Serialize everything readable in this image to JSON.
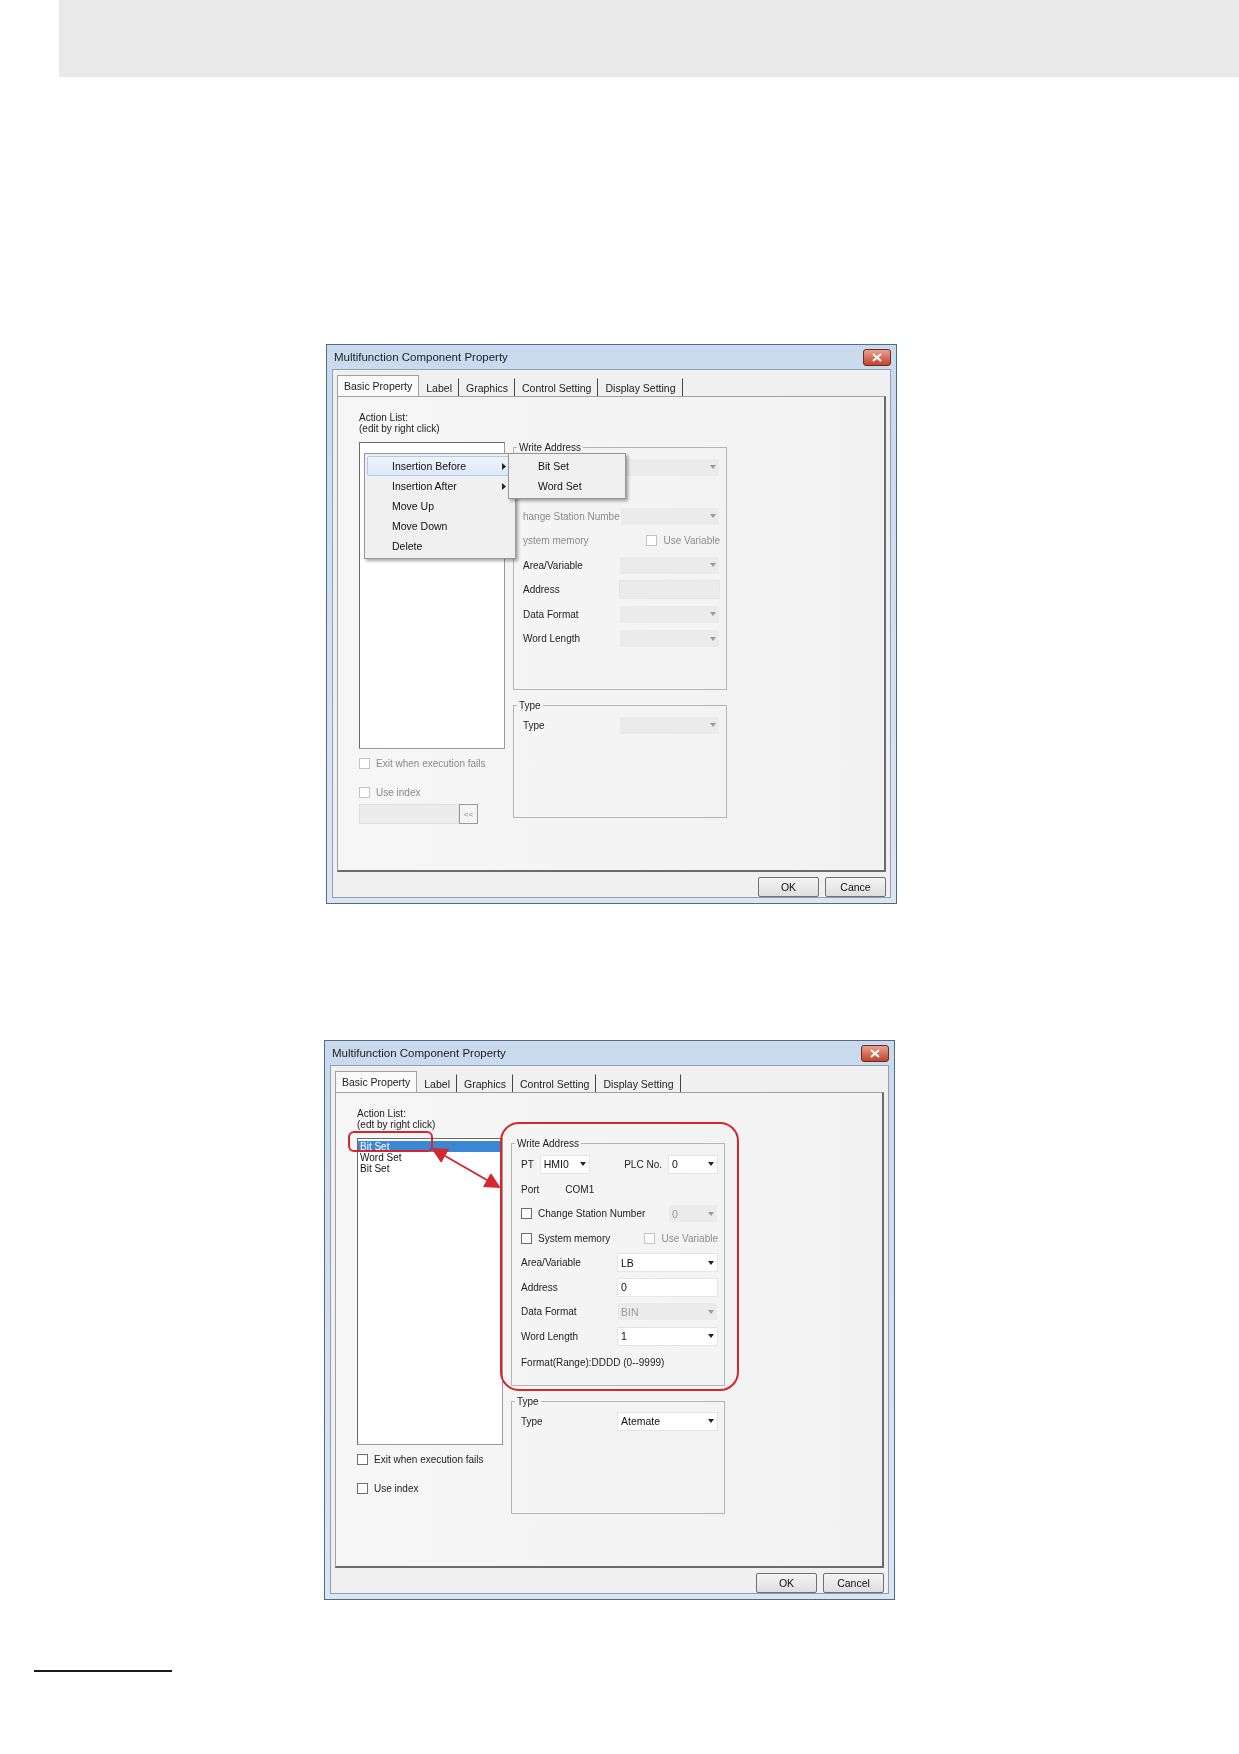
{
  "dialogs": [
    {
      "title": "Multifunction Component Property",
      "tabs": [
        {
          "label": "Basic Property",
          "selected": true
        },
        {
          "label": "Label",
          "selected": false
        },
        {
          "label": "Graphics",
          "selected": false
        },
        {
          "label": "Control Setting",
          "selected": false
        },
        {
          "label": "Display Setting",
          "selected": false
        }
      ],
      "action_list": {
        "label": "Action List:",
        "hint": "(edit by right click)"
      },
      "context_menu": {
        "items": [
          {
            "label": "Insertion Before",
            "selected": true,
            "submenu": true
          },
          {
            "label": "Insertion After",
            "selected": false,
            "submenu": true
          },
          {
            "label": "Move Up",
            "selected": false,
            "submenu": false
          },
          {
            "label": "Move Down",
            "selected": false,
            "submenu": false
          },
          {
            "label": "Delete",
            "selected": false,
            "submenu": false
          }
        ],
        "submenu_items": [
          {
            "label": "Bit Set",
            "selected": false
          },
          {
            "label": "Word Set",
            "selected": false
          }
        ]
      },
      "write_address": {
        "title": "Write Address",
        "rows": [
          {
            "kind": "select",
            "disabled": true
          },
          {
            "kind": "blank"
          },
          {
            "kind": "select",
            "label": "hange Station Numbe",
            "dimmed": true,
            "disabled": true
          },
          {
            "kind": "checkpair",
            "label": "ystem memory",
            "dimmed": true,
            "option": {
              "label": "Use Variable",
              "checked": false,
              "disabled": true
            }
          },
          {
            "kind": "select",
            "label": "Area/Variable",
            "dimmed": false,
            "disabled": true
          },
          {
            "kind": "input",
            "label": "Address",
            "dimmed": false,
            "disabled": true
          },
          {
            "kind": "select",
            "label": "Data Format",
            "dimmed": false,
            "disabled": true
          },
          {
            "kind": "select",
            "label": "Word Length",
            "dimmed": false,
            "disabled": true
          }
        ]
      },
      "type_group": {
        "title": "Type",
        "label": "Type",
        "disabled": true
      },
      "options": [
        {
          "label": "Exit when execution fails",
          "checked": false,
          "disabled": true
        },
        {
          "label": "Use index",
          "checked": false,
          "disabled": true
        }
      ],
      "index_field": {
        "button": "<<",
        "disabled": true
      },
      "buttons": [
        "OK",
        "Cance"
      ],
      "highlight": false
    },
    {
      "title": "Multifunction Component Property",
      "tabs": [
        {
          "label": "Basic Property",
          "selected": true
        },
        {
          "label": "Label",
          "selected": false
        },
        {
          "label": "Graphics",
          "selected": false
        },
        {
          "label": "Control Setting",
          "selected": false
        },
        {
          "label": "Display Setting",
          "selected": false
        }
      ],
      "action_list": {
        "label": "Action List:",
        "hint": "(edt by right click)",
        "items": [
          {
            "label": "Bit Set",
            "selected": true
          },
          {
            "label": "Word Set",
            "selected": false
          },
          {
            "label": "Bit Set",
            "selected": false
          }
        ]
      },
      "write_address": {
        "title": "Write Address",
        "rows": [
          {
            "kind": "pair",
            "label": "PT",
            "value": "HMI0",
            "label2": "PLC No.",
            "value2": "0"
          },
          {
            "kind": "info",
            "label": "Port",
            "value": "COM1"
          },
          {
            "kind": "select",
            "checkbox": {
              "checked": false
            },
            "label": "Change Station Number",
            "dimmed": false,
            "disabled": true,
            "value": "0"
          },
          {
            "kind": "checkpair",
            "checkbox": {
              "checked": false
            },
            "label": "System memory",
            "dimmed": false,
            "option": {
              "label": "Use Variable",
              "checked": false,
              "disabled": true
            }
          },
          {
            "kind": "select",
            "label": "Area/Variable",
            "value": "LB",
            "dimmed": false,
            "disabled": false
          },
          {
            "kind": "input",
            "label": "Address",
            "value": "0",
            "dimmed": false,
            "disabled": false
          },
          {
            "kind": "select",
            "label": "Data Format",
            "value": "BIN",
            "dimmed": false,
            "disabled": true
          },
          {
            "kind": "select",
            "label": "Word Length",
            "value": "1",
            "dimmed": false,
            "disabled": false
          },
          {
            "kind": "note",
            "text": "Format(Range):DDDD (0--9999)"
          }
        ]
      },
      "type_group": {
        "title": "Type",
        "label": "Type",
        "value": "Atemate",
        "disabled": false
      },
      "options": [
        {
          "label": "Exit when execution fails",
          "checked": false,
          "disabled": false
        },
        {
          "label": "Use index",
          "checked": false,
          "disabled": false
        }
      ],
      "buttons": [
        "OK",
        "Cancel"
      ],
      "highlight": true
    }
  ]
}
